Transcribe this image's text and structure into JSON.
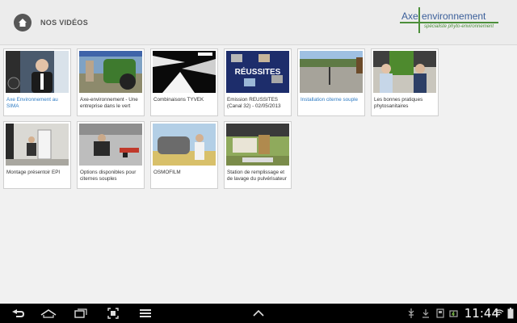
{
  "header": {
    "title": "NOS VIDÉOS",
    "logo_word1": "Axe",
    "logo_word2": "environnement",
    "logo_tagline": "spécialiste phyto-environnement",
    "accent": "#4c8f3a",
    "brand_blue": "#3b5f9a"
  },
  "videos": [
    {
      "title": "Axe Environnement au SIMA",
      "selected": true
    },
    {
      "title": "Axe-environnement - Une entreprise dans le vert",
      "selected": false
    },
    {
      "title": "Combinaisons TYVEK",
      "selected": false
    },
    {
      "title": "Emission REUSSITES (Canal 32) - 02/05/2013",
      "selected": false,
      "thumb_text": "RÉUSSITES"
    },
    {
      "title": "Installation citerne souple",
      "selected": true
    },
    {
      "title": "Les bonnes pratiques phytosanitaires",
      "selected": false
    },
    {
      "title": "Montage présentoir EPI",
      "selected": false
    },
    {
      "title": "Options disponibles pour citernes souples",
      "selected": false
    },
    {
      "title": "OSMOFILM",
      "selected": false
    },
    {
      "title": "Station de remplissage et de lavage du pulvérisateur",
      "selected": false
    }
  ],
  "navbar": {
    "icons": [
      "back-icon",
      "home-icon",
      "recent-apps-icon",
      "screenshot-icon",
      "menu-icon",
      "up-arrow-icon"
    ],
    "time": "11:44"
  }
}
